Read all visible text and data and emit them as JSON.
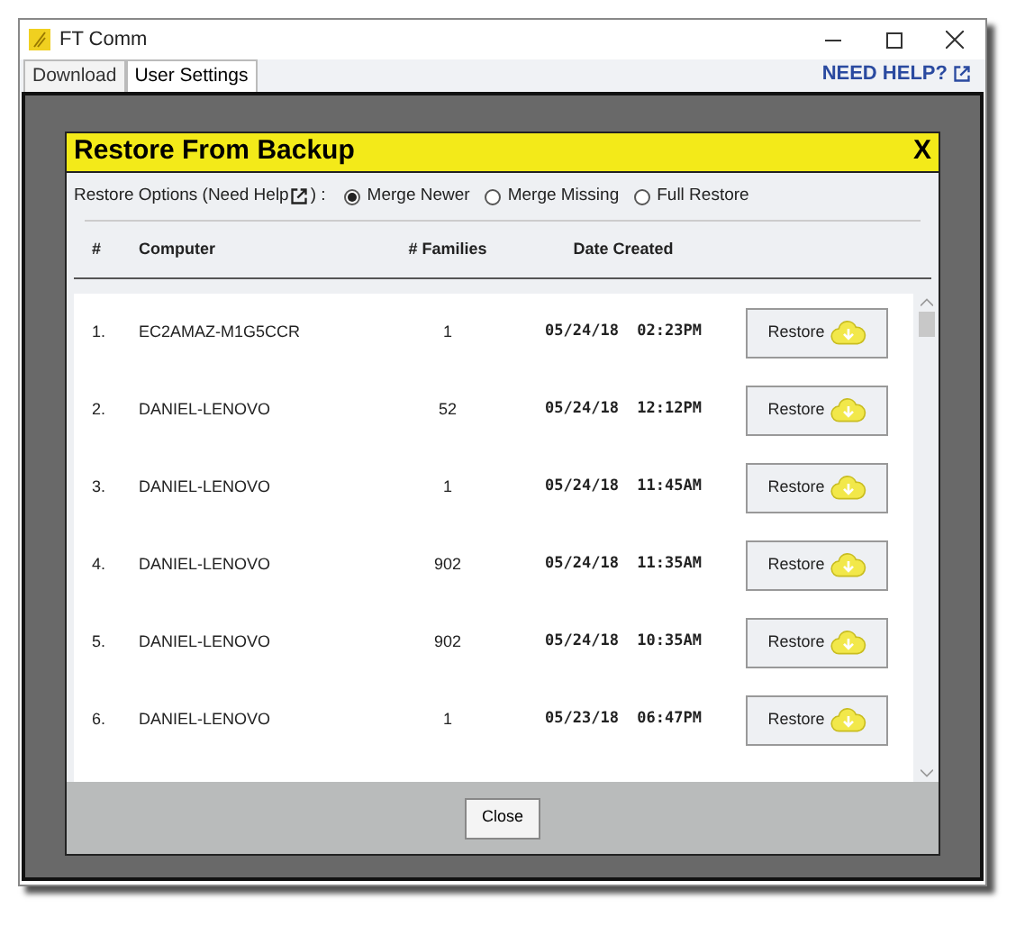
{
  "window": {
    "title": "FT Comm"
  },
  "tabs": [
    {
      "label": "Download",
      "selected": false
    },
    {
      "label": "User Settings",
      "selected": true
    }
  ],
  "help_link": "NEED HELP?",
  "dialog": {
    "title": "Restore From Backup",
    "close": "X",
    "options_label": "Restore Options (Need Help",
    "options_suffix": ") :",
    "options": [
      {
        "label": "Merge Newer",
        "selected": true
      },
      {
        "label": "Merge Missing",
        "selected": false
      },
      {
        "label": "Full Restore",
        "selected": false
      }
    ],
    "columns": [
      "#",
      "Computer",
      "# Families",
      "Date Created"
    ],
    "rows": [
      {
        "index": "1.",
        "computer": "EC2AMAZ-M1G5CCR",
        "families": "1",
        "date": "05/24/18  02:23PM",
        "action": "Restore"
      },
      {
        "index": "2.",
        "computer": "DANIEL-LENOVO",
        "families": "52",
        "date": "05/24/18  12:12PM",
        "action": "Restore"
      },
      {
        "index": "3.",
        "computer": "DANIEL-LENOVO",
        "families": "1",
        "date": "05/24/18  11:45AM",
        "action": "Restore"
      },
      {
        "index": "4.",
        "computer": "DANIEL-LENOVO",
        "families": "902",
        "date": "05/24/18  11:35AM",
        "action": "Restore"
      },
      {
        "index": "5.",
        "computer": "DANIEL-LENOVO",
        "families": "902",
        "date": "05/24/18  10:35AM",
        "action": "Restore"
      },
      {
        "index": "6.",
        "computer": "DANIEL-LENOVO",
        "families": "1",
        "date": "05/23/18  06:47PM",
        "action": "Restore"
      }
    ],
    "footer_button": "Close"
  }
}
